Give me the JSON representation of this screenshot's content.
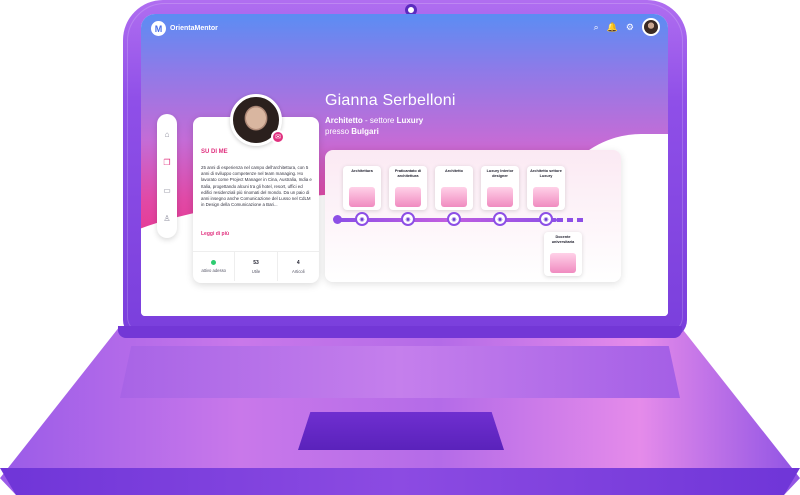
{
  "app": {
    "logo_mark": "M",
    "logo_text": "OrientaMentor"
  },
  "topbar": {
    "icons": [
      "search-icon",
      "bell-icon",
      "gear-icon"
    ],
    "search_glyph": "⌕",
    "bell_glyph": "🔔",
    "gear_glyph": "⚙"
  },
  "sidenav": {
    "items": [
      {
        "icon": "home-icon",
        "glyph": "⌂"
      },
      {
        "icon": "copy-icon",
        "glyph": "❐"
      },
      {
        "icon": "chat-icon",
        "glyph": "▭"
      },
      {
        "icon": "user-icon",
        "glyph": "♙"
      }
    ]
  },
  "profile": {
    "name": "Gianna Serbelloni",
    "role_bold": "Architetto",
    "role_rest": " - settore ",
    "sector": "Luxury",
    "company_prefix": "presso ",
    "company": "Bulgari",
    "chat_glyph": "✉"
  },
  "about": {
    "title": "SU DI ME",
    "text": "25 anni di esperienza nel campo dell'architettura, con 5 anni di sviluppo competenze nel team managing. Ho lavorato come Project Manager in Cina, Australia, India e Italia, progettando alcuni tra gli hotel, resort, uffici ed edifici residenziali più rinomati del mondo. Da un paio di anni insegno anche Comunicazione del Lusso nel CdLM in Design della Comunicazione a Bari...",
    "read_more": "Leggi di più"
  },
  "stats": [
    {
      "value": "",
      "label": "attivo adesso"
    },
    {
      "value": "53",
      "label": "Utile"
    },
    {
      "value": "4",
      "label": "Articoli"
    }
  ],
  "timeline": {
    "steps": [
      "Architettura",
      "Praticantato di architettura",
      "Architetto",
      "Luxury Interior designer",
      "Architetto settore Luxury"
    ],
    "side_step": "Docente universitaria",
    "node_glyph": "◉"
  },
  "colors": {
    "accent": "#e0307e",
    "purple": "#8d4fe6",
    "hero_top": "#5b8df3",
    "hero_bottom": "#e8368f"
  }
}
